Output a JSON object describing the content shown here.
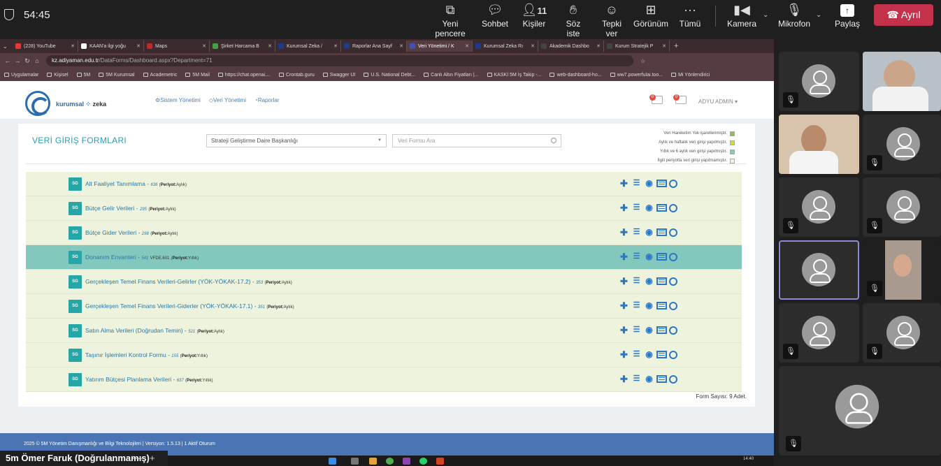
{
  "meeting": {
    "timer": "54:45",
    "buttons": [
      {
        "label": "Yeni pencere",
        "icon": "new-window-icon"
      },
      {
        "label": "Sohbet",
        "icon": "chat-icon"
      },
      {
        "label": "Kişiler",
        "icon": "people-icon",
        "count": "11"
      },
      {
        "label": "Söz iste",
        "icon": "raise-hand-icon"
      },
      {
        "label": "Tepki ver",
        "icon": "reaction-icon"
      },
      {
        "label": "Görünüm",
        "icon": "view-icon"
      },
      {
        "label": "Tümü",
        "icon": "more-icon"
      }
    ],
    "camera": "Kamera",
    "mic": "Mikrofon",
    "share": "Paylaş",
    "leave": "Ayrıl",
    "leave_color": "#c4314b",
    "self_name": "5m Ömer Faruk (Doğrulanmamış)"
  },
  "browser": {
    "tabs": [
      {
        "label": "(228) YouTube",
        "color": "#e53935"
      },
      {
        "label": "KAAN'a ilgi yoğu",
        "color": "#ffffff"
      },
      {
        "label": "Maps",
        "color": "#c62828"
      },
      {
        "label": "Şirket Harcama B",
        "color": "#43a047"
      },
      {
        "label": "Kurumsal Zeka / ",
        "color": "#1e3a8a"
      },
      {
        "label": "Raporlar Ana Sayf",
        "color": "#1e3a8a"
      },
      {
        "label": "Veri Yönetimi / K",
        "color": "#3f51b5"
      },
      {
        "label": "Kurumsal Zeka Rı",
        "color": "#1e3a8a"
      },
      {
        "label": "Akademik Dashbo",
        "color": "#444444"
      },
      {
        "label": "Kurum Stratejik P",
        "color": "#444444"
      }
    ],
    "url_host": "kz.adiyaman.edu.tr",
    "url_path": "/DataForms/Dashboard.aspx?Department=71",
    "bookmarks": [
      "Uygulamalar",
      "Kişisel",
      "5M",
      "5M Kurumsal",
      "Academetric",
      "5M Mail",
      "https://chat.openai....",
      "Crontab.guru",
      "Swagger UI",
      "U.S. National Debt...",
      "Canlı Altın Fiyatları |...",
      "KASKİ 5M İş Takip -...",
      "web-dashboard-ho...",
      "ww7.powerfulai.too...",
      "Mi Yönlendirici"
    ]
  },
  "app": {
    "brand_a": "kurumsal",
    "brand_b": "zeka",
    "nav": [
      "Sistem Yönetimi",
      "Veri Yönetimi",
      "Raporlar"
    ],
    "badges": [
      "0",
      "0"
    ],
    "user": "ADYU ADMIN"
  },
  "panel": {
    "title": "VERİ GİRİŞ FORMLARI",
    "department": "Strateji Geliştirme Daire Başkanlığı",
    "search_placeholder": "Veri Formu Ara",
    "legend": [
      {
        "label": "Veri Hareketim Yok işaretlenmiştir.",
        "color": "#8bc34a"
      },
      {
        "label": "Aylık ve haftalık veri girişi yapılmıştır.",
        "color": "#cddc39"
      },
      {
        "label": "Yıllık ve 6 aylık veri girişi yapılmıştır.",
        "color": "#80cbc4"
      },
      {
        "label": "İlgili periyotta veri girişi yapılmamıştır.",
        "color": "#f1f4de"
      }
    ],
    "count_text": "Form Sayısı: 9 Adet.",
    "forms": [
      {
        "badge": "SG",
        "name": "Alt Faaliyet Tanımlama",
        "id": "636",
        "code": "",
        "period": "Aylık",
        "highlight": false
      },
      {
        "badge": "SG",
        "name": "Bütçe Gelir Verileri",
        "id": "295",
        "code": "",
        "period": "Aylık",
        "highlight": false
      },
      {
        "badge": "SG",
        "name": "Bütçe Gider Verileri",
        "id": "298",
        "code": "",
        "period": "Aylık",
        "highlight": false
      },
      {
        "badge": "SG",
        "name": "Donanım Envanteri",
        "id": "541",
        "code": "VFDE.601",
        "period": "Yıllık",
        "highlight": true
      },
      {
        "badge": "SG",
        "name": "Gerçekleşen Temel Finans Verileri-Gelirler (YÖK-YÖKAK-17.2)",
        "id": "353",
        "code": "",
        "period": "Aylık",
        "highlight": false
      },
      {
        "badge": "SG",
        "name": "Gerçekleşen Temel Finans Verileri-Giderler (YÖK-YÖKAK-17.1)",
        "id": "351",
        "code": "",
        "period": "Aylık",
        "highlight": false
      },
      {
        "badge": "SG",
        "name": "Satın Alma Verileri (Doğrudan Temin)",
        "id": "521",
        "code": "",
        "period": "Aylık",
        "highlight": false
      },
      {
        "badge": "SG",
        "name": "Taşınır İşlemleri Kontrol Formu",
        "id": "155",
        "code": "",
        "period": "Yıllık",
        "highlight": false
      },
      {
        "badge": "SG",
        "name": "Yatırım Bütçesi Planlama Verileri",
        "id": "637",
        "code": "",
        "period": "Yıllık",
        "highlight": false
      }
    ],
    "period_label": "Periyot:",
    "footer": "2025 © 5M Yönetim Danışmanlığı ve Bilgi Teknolojileri | Versiyon: 1.5.13 | 1 Aktif Oturum"
  },
  "taskbar": {
    "time": "14:40"
  }
}
